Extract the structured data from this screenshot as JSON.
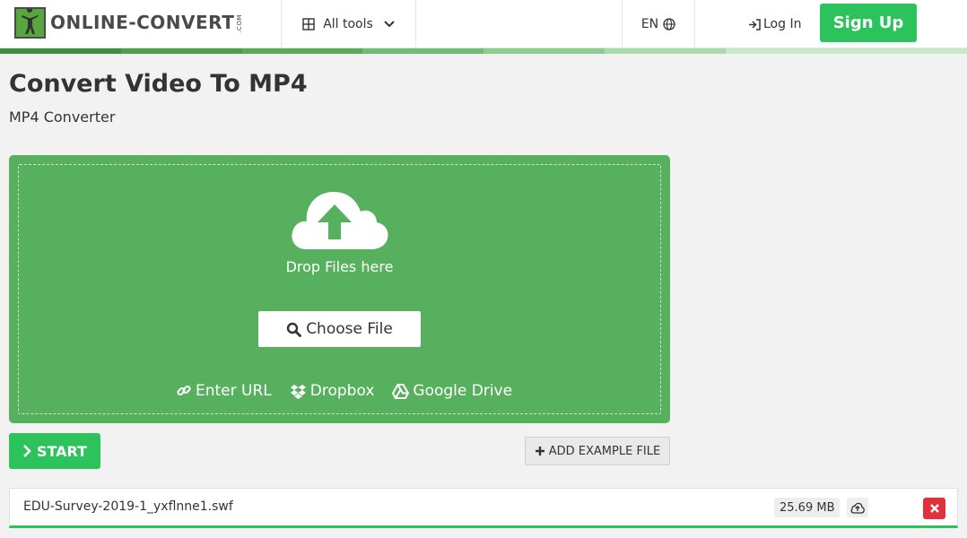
{
  "header": {
    "logo_text": "ONLINE-CONVERT",
    "logo_suffix": ".COM",
    "all_tools_label": "All tools",
    "language": "EN",
    "login_label": "Log In",
    "signup_label": "Sign Up"
  },
  "page": {
    "title": "Convert Video To MP4",
    "subtitle": "MP4 Converter"
  },
  "dropzone": {
    "drop_label": "Drop Files here",
    "choose_label": "Choose File",
    "sources": [
      {
        "label": "Enter URL",
        "icon": "link-icon"
      },
      {
        "label": "Dropbox",
        "icon": "dropbox-icon"
      },
      {
        "label": "Google Drive",
        "icon": "google-drive-icon"
      }
    ]
  },
  "actions": {
    "start_label": "START",
    "add_example_label": "ADD EXAMPLE FILE"
  },
  "file": {
    "name": "EDU-Survey-2019-1_yxflnne1.swf",
    "size": "25.69 MB",
    "upload_progress": 1.0
  },
  "colors": {
    "brand_green": "#57b05e",
    "button_green": "#2cc25c",
    "danger": "#e0313d",
    "stripes": [
      "#3e8e41",
      "#4a9e4d",
      "#57ab5a",
      "#6fbd72",
      "#8ccc8e",
      "#a9dbab",
      "#c7e9c8"
    ]
  }
}
